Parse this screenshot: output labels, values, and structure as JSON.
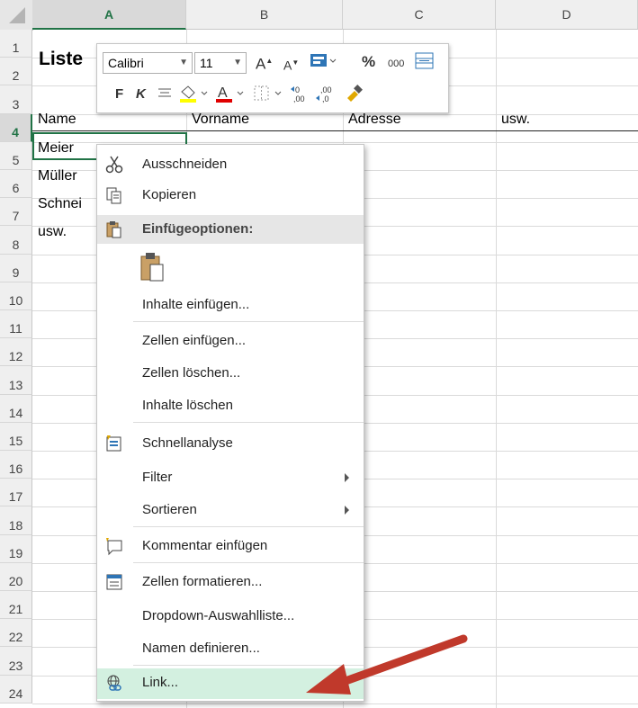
{
  "columns": [
    "A",
    "B",
    "C",
    "D"
  ],
  "rows": [
    "1",
    "2",
    "3",
    "4",
    "5",
    "6",
    "7",
    "8",
    "9",
    "10",
    "11",
    "12",
    "13",
    "14",
    "15",
    "16",
    "17",
    "18",
    "19",
    "20",
    "21",
    "22",
    "23",
    "24"
  ],
  "cells": {
    "a1": "Liste",
    "a3": "Name",
    "b3": "Vorname",
    "c3": "Adresse",
    "d3": "usw.",
    "a4": "Meier",
    "a5": "Müller",
    "a6": "Schnei",
    "a7": "usw."
  },
  "mini_toolbar": {
    "font": "Calibri",
    "size": "11",
    "bold": "F",
    "italic": "K",
    "percent": "%",
    "thousands": "000",
    "increase_font": "A",
    "decrease_font": "A"
  },
  "menu": {
    "cut": "Ausschneiden",
    "copy": "Kopieren",
    "paste_options": "Einfügeoptionen:",
    "paste_special": "Inhalte einfügen...",
    "insert_cells": "Zellen einfügen...",
    "delete_cells": "Zellen löschen...",
    "clear_contents": "Inhalte löschen",
    "quick_analysis": "Schnellanalyse",
    "filter": "Filter",
    "sort": "Sortieren",
    "insert_comment": "Kommentar einfügen",
    "format_cells": "Zellen formatieren...",
    "dropdown_list": "Dropdown-Auswahlliste...",
    "define_name": "Namen definieren...",
    "link": "Link..."
  },
  "colors": {
    "excel_green": "#217346",
    "highlight": "#d3f0e0",
    "arrow": "#c0392b"
  }
}
